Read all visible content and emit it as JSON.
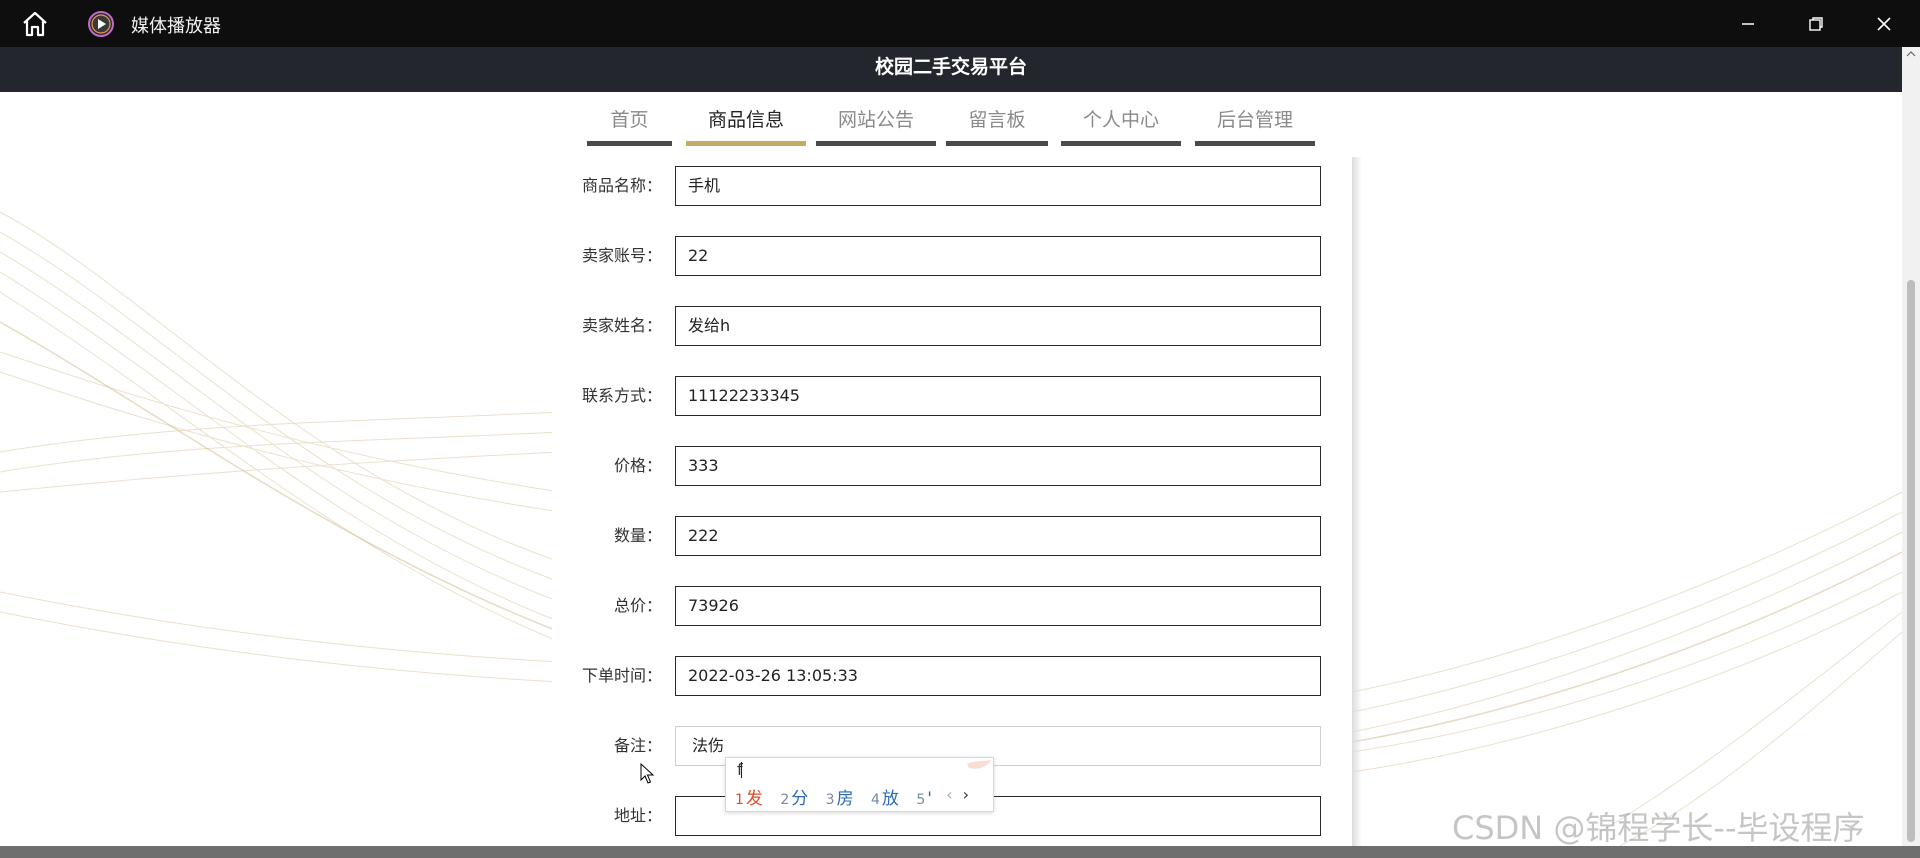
{
  "app": {
    "title": "媒体播放器"
  },
  "site": {
    "title": "校园二手交易平台"
  },
  "nav": {
    "items": [
      {
        "label": "首页",
        "active": false
      },
      {
        "label": "商品信息",
        "active": true
      },
      {
        "label": "网站公告",
        "active": false
      },
      {
        "label": "留言板",
        "active": false
      },
      {
        "label": "个人中心",
        "active": false
      },
      {
        "label": "后台管理",
        "active": false
      }
    ]
  },
  "form": {
    "fields": [
      {
        "label": "商品名称：",
        "value": "手机"
      },
      {
        "label": "卖家账号：",
        "value": "22"
      },
      {
        "label": "卖家姓名：",
        "value": "发给h"
      },
      {
        "label": "联系方式：",
        "value": "11122233345"
      },
      {
        "label": "价格：",
        "value": "333"
      },
      {
        "label": "数量：",
        "value": "222"
      },
      {
        "label": "总价：",
        "value": "73926"
      },
      {
        "label": "下单时间：",
        "value": "2022-03-26 13:05:33"
      },
      {
        "label": "备注：",
        "value": "法伤"
      },
      {
        "label": "地址：",
        "value": ""
      }
    ]
  },
  "ime": {
    "composition": "f",
    "candidates": [
      {
        "num": "1",
        "text": "发"
      },
      {
        "num": "2",
        "text": "分"
      },
      {
        "num": "3",
        "text": "房"
      },
      {
        "num": "4",
        "text": "放"
      },
      {
        "num": "5",
        "text": "'"
      }
    ],
    "prev": "‹",
    "next": "›"
  },
  "watermark": "CSDN @锦程学长--毕设程序",
  "colors": {
    "accent": "#c7a865",
    "header_bg": "#24262d",
    "titlebar_bg": "#0e0e0e"
  }
}
